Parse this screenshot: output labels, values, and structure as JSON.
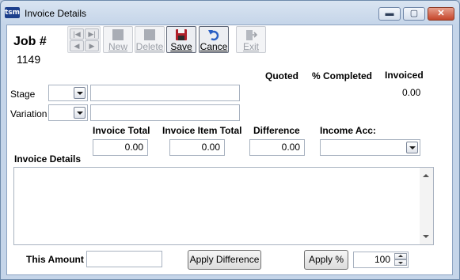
{
  "window": {
    "title": "Invoice Details",
    "app_icon_text": "tsm",
    "controls": {
      "minimize": "▬",
      "maximize": "▢",
      "close": "✕"
    }
  },
  "job": {
    "label": "Job #",
    "number": "1149"
  },
  "toolbar": {
    "new_label": "New",
    "delete_label": "Delete",
    "save_label": "Save",
    "cancel_label": "Cance",
    "exit_label": "Exit"
  },
  "summary": {
    "quoted_label": "Quoted",
    "percent_completed_label": "% Completed",
    "invoiced_label": "Invoiced",
    "invoiced_value": "0.00"
  },
  "form": {
    "stage_label": "Stage",
    "variation_label": "Variation",
    "invoice_total_label": "Invoice Total",
    "invoice_total_value": "0.00",
    "invoice_item_total_label": "Invoice Item Total",
    "invoice_item_total_value": "0.00",
    "difference_label": "Difference",
    "difference_value": "0.00",
    "income_acc_label": "Income Acc:",
    "invoice_details_label": "Invoice Details",
    "this_amount_label": "This Amount",
    "apply_difference_label": "Apply Difference",
    "apply_percent_label": "Apply %",
    "percent_value": "100"
  },
  "colors": {
    "accent": "#1c3f8c",
    "save_icon": "#b0202a",
    "cancel_icon": "#2a5fc4"
  }
}
